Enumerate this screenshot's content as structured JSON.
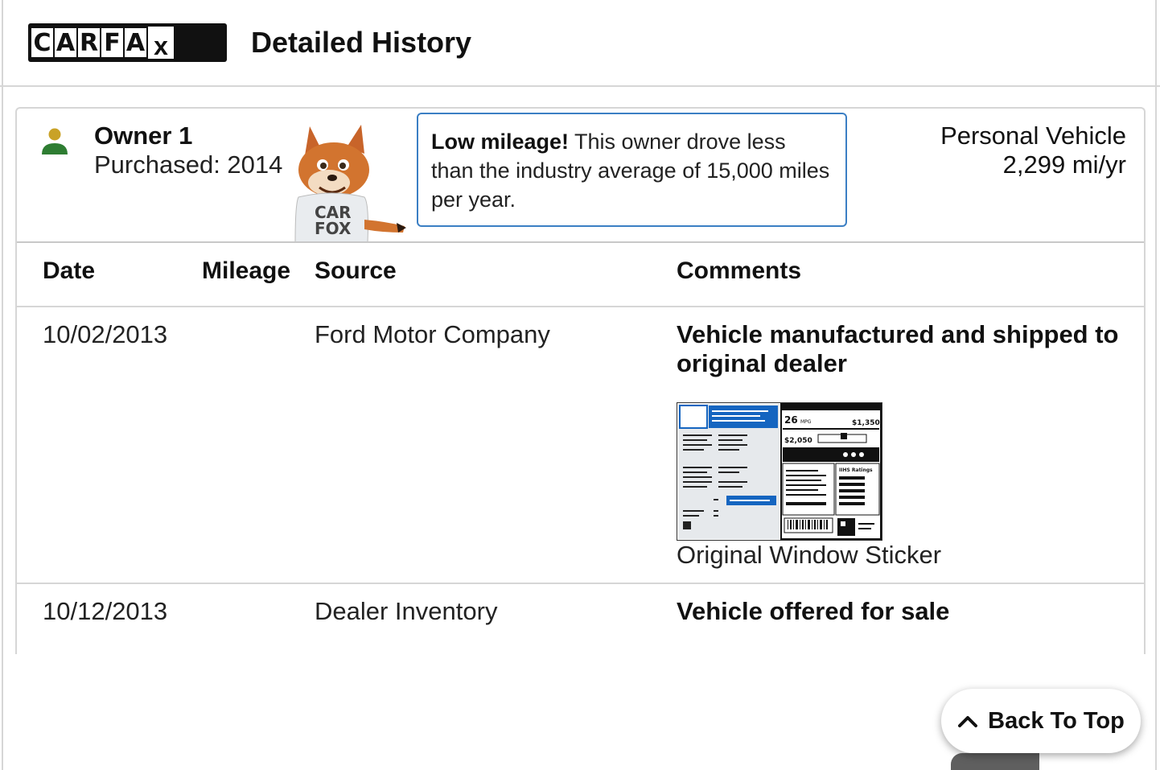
{
  "header": {
    "logo_letters": [
      "C",
      "A",
      "R",
      "F",
      "A"
    ],
    "logo_x": "x",
    "title": "Detailed History"
  },
  "owner": {
    "title": "Owner 1",
    "purchased": "Purchased: 2014",
    "vehicle_type": "Personal Vehicle",
    "miles_per_year": "2,299 mi/yr",
    "alert_bold": "Low mileage!",
    "alert_text": " This owner drove less than the industry average of 15,000 miles per year."
  },
  "table": {
    "headers": {
      "date": "Date",
      "mileage": "Mileage",
      "source": "Source",
      "comments": "Comments"
    },
    "rows": [
      {
        "date": "10/02/2013",
        "mileage": "",
        "source": "Ford Motor Company",
        "comment": "Vehicle manufactured and shipped to original dealer",
        "attachment_caption": "Original Window Sticker"
      },
      {
        "date": "10/12/2013",
        "mileage": "",
        "source": "Dealer Inventory",
        "comment": "Vehicle offered for sale"
      }
    ]
  },
  "sticker": {
    "mpg": "26",
    "mpg_unit": "MPG",
    "save": "$1,350",
    "cost": "$2,050",
    "ratings": "IIHS Ratings"
  },
  "back_to_top": "Back To Top",
  "colors": {
    "owner_head": "#c9a227",
    "owner_body": "#2e7d32",
    "alert_border": "#3b7fc4"
  }
}
